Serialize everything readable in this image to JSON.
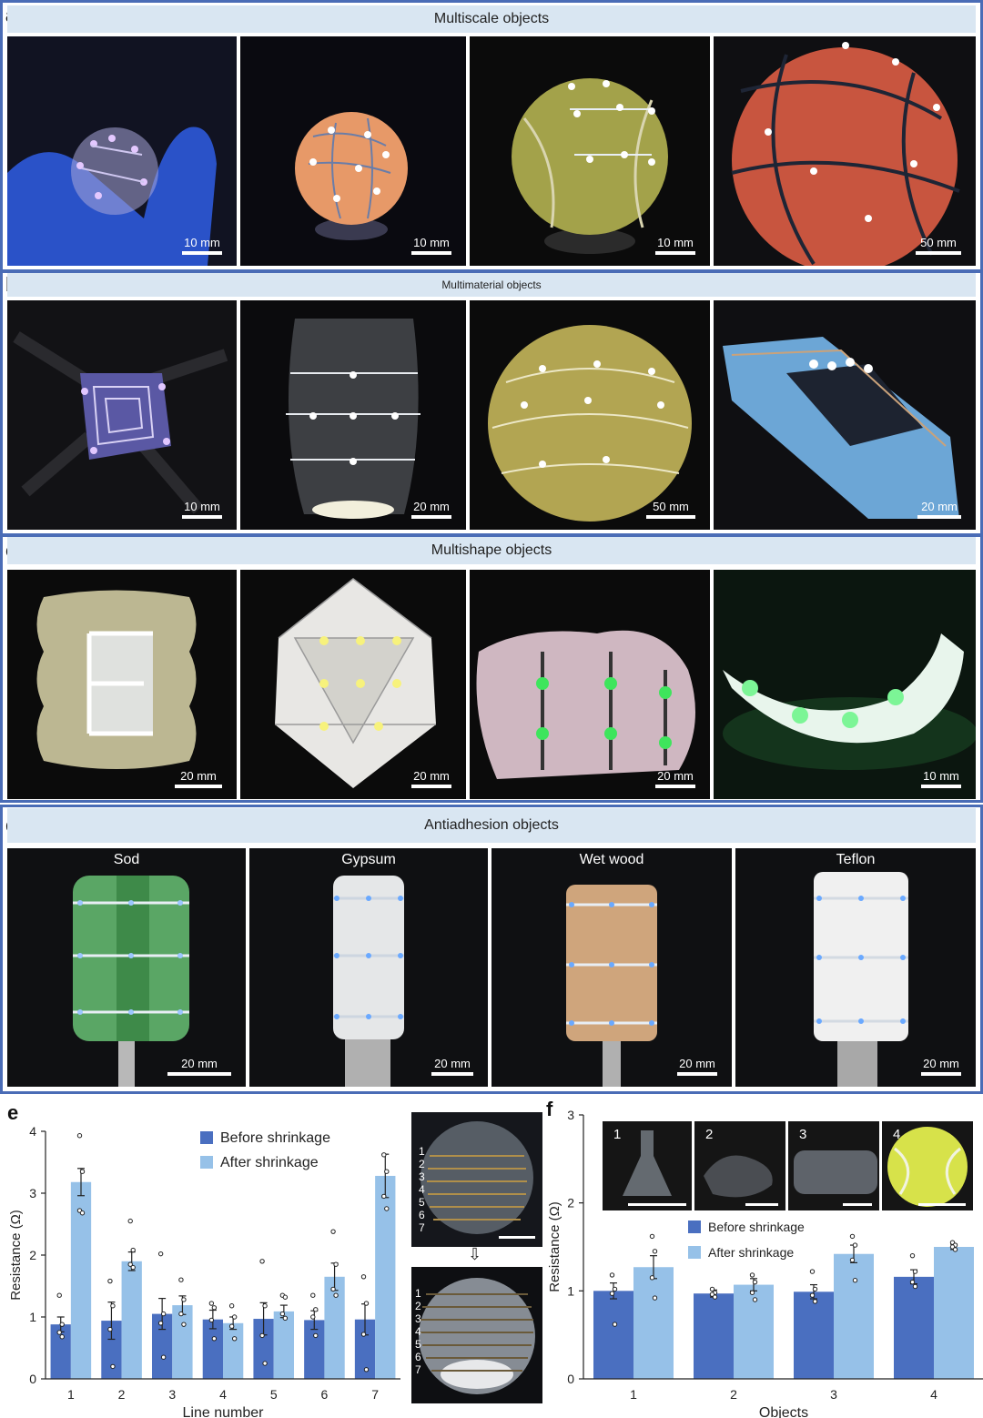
{
  "panels": {
    "a": {
      "letter": "a",
      "title": "Multiscale objects",
      "scales": [
        "10 mm",
        "10 mm",
        "10 mm",
        "50 mm"
      ]
    },
    "b": {
      "letter": "b",
      "title": "Multimaterial objects",
      "scales": [
        "10 mm",
        "20 mm",
        "50 mm",
        "20 mm"
      ]
    },
    "c": {
      "letter": "c",
      "title": "Multishape objects",
      "scales": [
        "20 mm",
        "20 mm",
        "20 mm",
        "10 mm"
      ]
    },
    "d": {
      "letter": "d",
      "title": "Antiadhesion objects",
      "labels": [
        "Sod",
        "Gypsum",
        "Wet wood",
        "Teflon"
      ],
      "scales": [
        "20 mm",
        "20 mm",
        "20 mm",
        "20 mm"
      ]
    },
    "e": {
      "letter": "e"
    },
    "f": {
      "letter": "f"
    }
  },
  "inset_e": {
    "numbers": [
      "1",
      "2",
      "3",
      "4",
      "5",
      "6",
      "7"
    ],
    "arrow": "⇩"
  },
  "inset_f": {
    "numbers": [
      "1",
      "2",
      "3",
      "4"
    ]
  },
  "colors": {
    "before": "#4a6fc0",
    "after": "#96c1e8",
    "frame": "#4a6cb6",
    "banner": "#d9e6f2"
  },
  "chart_data": [
    {
      "type": "bar",
      "panel": "e",
      "categories": [
        "1",
        "2",
        "3",
        "4",
        "5",
        "6",
        "7"
      ],
      "series": [
        {
          "name": "Before shrinkage",
          "values": [
            0.88,
            0.94,
            1.05,
            0.96,
            0.97,
            0.95,
            0.96
          ],
          "errors": [
            0.12,
            0.3,
            0.25,
            0.15,
            0.26,
            0.15,
            0.25
          ]
        },
        {
          "name": "After shrinkage",
          "values": [
            3.18,
            1.9,
            1.19,
            0.9,
            1.09,
            1.65,
            3.28
          ],
          "errors": [
            0.22,
            0.15,
            0.15,
            0.1,
            0.1,
            0.22,
            0.35
          ]
        }
      ],
      "points": [
        [
          [
            1.35,
            0.88,
            0.75,
            0.68
          ],
          [
            3.93,
            3.35,
            2.72,
            2.68
          ]
        ],
        [
          [
            1.58,
            1.18,
            0.8,
            0.2
          ],
          [
            2.55,
            2.08,
            1.85,
            1.8
          ]
        ],
        [
          [
            2.02,
            1.05,
            0.9,
            0.35
          ],
          [
            1.6,
            1.28,
            1.05,
            0.88
          ]
        ],
        [
          [
            1.22,
            1.15,
            0.95,
            0.65
          ],
          [
            1.18,
            1.0,
            0.85,
            0.65
          ]
        ],
        [
          [
            1.9,
            1.18,
            0.7,
            0.25
          ],
          [
            1.35,
            1.32,
            1.05,
            0.98
          ]
        ],
        [
          [
            1.35,
            1.12,
            1.0,
            0.7
          ],
          [
            2.38,
            1.85,
            1.45,
            1.35
          ]
        ],
        [
          [
            1.65,
            1.22,
            0.72,
            0.15
          ],
          [
            3.62,
            3.35,
            2.95,
            2.75
          ]
        ]
      ],
      "xlabel": "Line number",
      "ylabel": "Resistance (Ω)",
      "ylim": [
        0,
        4
      ],
      "yticks": [
        "0",
        "1",
        "2",
        "3",
        "4"
      ],
      "legend": "top-right"
    },
    {
      "type": "bar",
      "panel": "f",
      "categories": [
        "1",
        "2",
        "3",
        "4"
      ],
      "series": [
        {
          "name": "Before shrinkage",
          "values": [
            1.0,
            0.97,
            0.99,
            1.16
          ],
          "errors": [
            0.09,
            0.04,
            0.08,
            0.08
          ]
        },
        {
          "name": "After shrinkage",
          "values": [
            1.27,
            1.07,
            1.42,
            1.5
          ],
          "errors": [
            0.13,
            0.07,
            0.1,
            0.03
          ]
        }
      ],
      "points": [
        [
          [
            1.18,
            1.02,
            0.97,
            0.62
          ],
          [
            1.62,
            1.45,
            1.15,
            0.92
          ]
        ],
        [
          [
            1.02,
            0.98,
            0.96,
            0.93
          ],
          [
            1.18,
            1.1,
            0.98,
            0.9
          ]
        ],
        [
          [
            1.22,
            1.02,
            0.95,
            0.88
          ],
          [
            1.62,
            1.52,
            1.35,
            1.12
          ]
        ],
        [
          [
            1.4,
            1.22,
            1.1,
            1.05
          ],
          [
            1.55,
            1.52,
            1.5,
            1.47
          ]
        ]
      ],
      "xlabel": "Objects",
      "ylabel": "Resistance (Ω)",
      "ylim": [
        0,
        3
      ],
      "yticks": [
        "0",
        "1",
        "2",
        "3"
      ],
      "legend": "top-center"
    }
  ]
}
